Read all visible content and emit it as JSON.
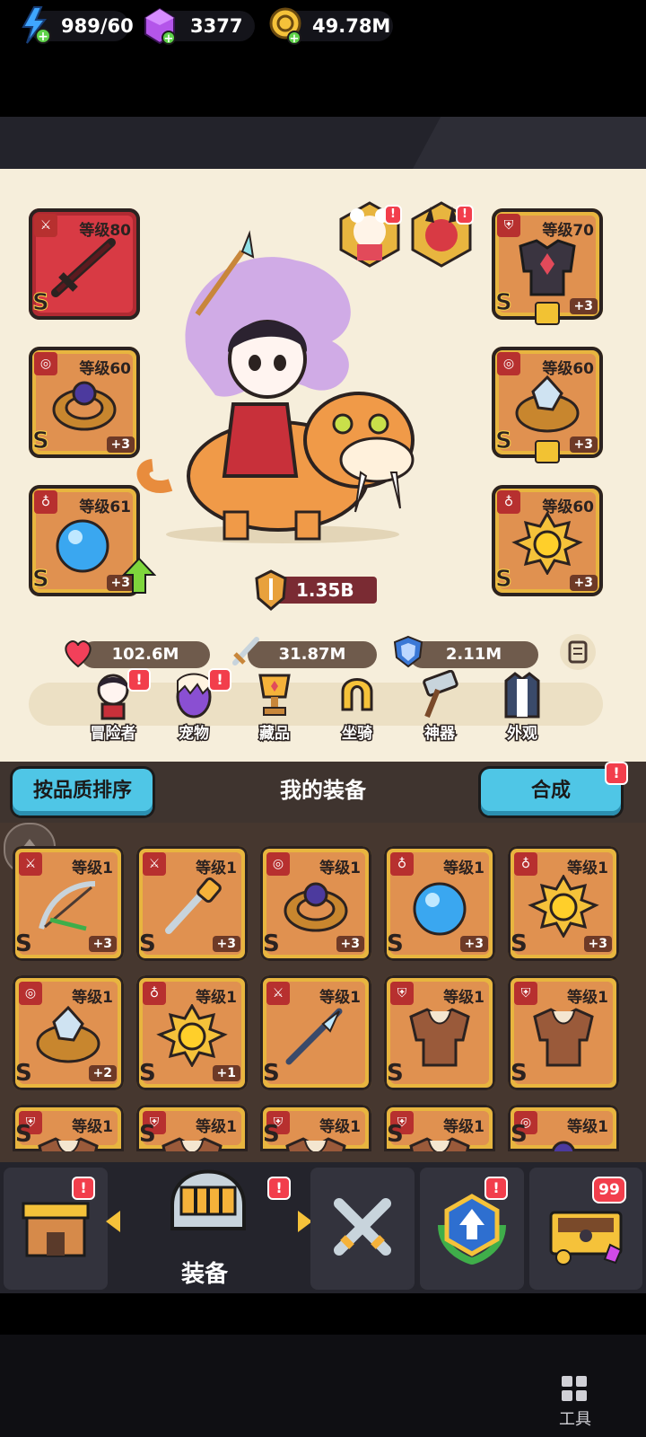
{
  "resources": {
    "energy": "989/60",
    "gems": "3377",
    "gold": "49.78M"
  },
  "equipped": [
    {
      "level": "等级80",
      "grade": "S",
      "plus": "",
      "slot": "sword"
    },
    {
      "level": "等级70",
      "grade": "S",
      "plus": "+3",
      "slot": "armor",
      "locked": true
    },
    {
      "level": "等级60",
      "grade": "S",
      "plus": "+3",
      "slot": "ring"
    },
    {
      "level": "等级60",
      "grade": "S",
      "plus": "+3",
      "slot": "ring",
      "locked": true
    },
    {
      "level": "等级61",
      "grade": "S",
      "plus": "+3",
      "slot": "necklace",
      "upgrade": true
    },
    {
      "level": "等级60",
      "grade": "S",
      "plus": "+3",
      "slot": "necklace"
    }
  ],
  "power": "1.35B",
  "stats": {
    "hp": "102.6M",
    "attack": "31.87M",
    "defense": "2.11M"
  },
  "menu": [
    {
      "label": "冒险者",
      "icon": "adventurer-icon",
      "badge": "!"
    },
    {
      "label": "宠物",
      "icon": "pet-egg-icon",
      "badge": "!"
    },
    {
      "label": "藏品",
      "icon": "trophy-icon",
      "badge": ""
    },
    {
      "label": "坐骑",
      "icon": "horseshoe-icon",
      "badge": ""
    },
    {
      "label": "神器",
      "icon": "hammer-icon",
      "badge": ""
    },
    {
      "label": "外观",
      "icon": "outfit-icon",
      "badge": ""
    }
  ],
  "equipment_header": {
    "sort_label": "按品质排序",
    "title": "我的装备",
    "merge_label": "合成",
    "merge_badge": "!"
  },
  "inventory": [
    {
      "level": "等级1",
      "grade": "S",
      "plus": "+3",
      "item": "bow-icon"
    },
    {
      "level": "等级1",
      "grade": "S",
      "plus": "+3",
      "item": "staff-icon"
    },
    {
      "level": "等级1",
      "grade": "S",
      "plus": "+3",
      "item": "ring-icon"
    },
    {
      "level": "等级1",
      "grade": "S",
      "plus": "+3",
      "item": "orb-icon"
    },
    {
      "level": "等级1",
      "grade": "S",
      "plus": "+3",
      "item": "medal-icon"
    },
    {
      "level": "等级1",
      "grade": "S",
      "plus": "+2",
      "item": "crystal-ring-icon"
    },
    {
      "level": "等级1",
      "grade": "S",
      "plus": "+1",
      "item": "medal-icon"
    },
    {
      "level": "等级1",
      "grade": "S",
      "plus": "",
      "item": "spear-icon"
    },
    {
      "level": "等级1",
      "grade": "S",
      "plus": "",
      "item": "armor-icon"
    },
    {
      "level": "等级1",
      "grade": "S",
      "plus": "",
      "item": "armor-icon"
    },
    {
      "level": "等级1",
      "grade": "S",
      "plus": "",
      "item": "armor-icon"
    },
    {
      "level": "等级1",
      "grade": "S",
      "plus": "",
      "item": "armor-icon"
    },
    {
      "level": "等级1",
      "grade": "S",
      "plus": "",
      "item": "armor-icon"
    },
    {
      "level": "等级1",
      "grade": "S",
      "plus": "",
      "item": "armor-icon"
    },
    {
      "level": "等级1",
      "grade": "S",
      "plus": "",
      "item": "ring-icon"
    }
  ],
  "bottom_nav": {
    "active_label": "装备",
    "shop_badge": "!",
    "equip_badge": "!",
    "upgrade_badge": "!",
    "chest_badge": "99"
  },
  "system": {
    "tools_label": "工具"
  },
  "colors": {
    "panel_bg": "#f6eedb",
    "slot_gold": "#e8b53f",
    "slot_orange": "#e09150",
    "accent_blue": "#4fc6e6",
    "badge_red": "#f23e4c"
  }
}
